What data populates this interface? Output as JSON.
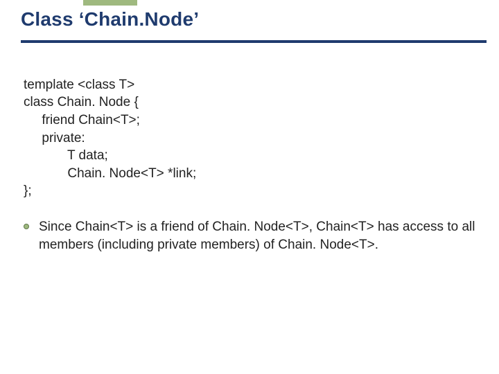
{
  "title": "Class ‘Chain.Node’",
  "code": {
    "lines": [
      "template <class T>",
      "class Chain. Node {",
      "     friend Chain<T>;",
      "     private:",
      "            T data;",
      "            Chain. Node<T> *link;",
      "};"
    ]
  },
  "bullets": [
    "Since Chain<T> is a friend of Chain. Node<T>, Chain<T> has access to all members (including private members) of Chain. Node<T>."
  ]
}
